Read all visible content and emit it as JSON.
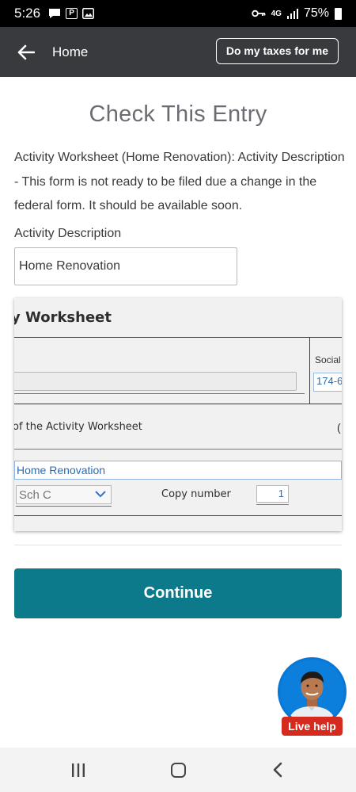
{
  "status_bar": {
    "time": "5:26",
    "network": "4G",
    "network_sub": "LTE",
    "battery": "75%"
  },
  "app_bar": {
    "title": "Home",
    "action_label": "Do my taxes for me"
  },
  "main": {
    "heading": "Check This Entry",
    "description": "Activity Worksheet (Home Renovation): Activity Description - This form is not ready to be filed due a change in the federal form. It should be available soon.",
    "field_label": "Activity Description",
    "field_value": "Home Renovation"
  },
  "form_image": {
    "title": "y Worksheet",
    "social_label": "Social",
    "ssn_partial": "174-6",
    "section_text": "of the Activity Worksheet",
    "paren": "(",
    "activity_value": "Home Renovation",
    "select_value": "Sch C",
    "copy_label": "Copy number",
    "copy_value": "1"
  },
  "continue_label": "Continue",
  "live_help_label": "Live help",
  "colors": {
    "app_bar_bg": "#393a3d",
    "continue_bg": "#0d7a8c",
    "live_help_red": "#d52b1e",
    "live_help_blue": "#0877d6"
  }
}
